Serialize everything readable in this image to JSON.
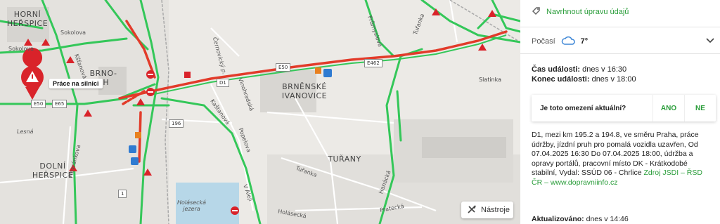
{
  "map": {
    "places": {
      "horni_herspice": "HORNÍ\nHEŘSPICE",
      "brno_jih": "BRNO-\nJIH",
      "brnenske_ivanovice": "BRNĚNSKÉ\nIVANOVICE",
      "turany": "TUŘANY",
      "dolni_herspice": "DOLNÍ\nHEŘSPICE",
      "slatinka": "Slatinka"
    },
    "streets": {
      "sokolova_top": "Sokolova",
      "sokolova_left": "Sokolova",
      "kstanova": "Kšťanová",
      "kastanova": "Kaštanová",
      "vinarska": "Vinohradská",
      "popelova": "Popelova",
      "havranova": "Havránkova",
      "lesna": "Lesná",
      "prumyslova": "Průmyslová",
      "turanka1": "Tuřanka",
      "turanka2": "Tuřanka",
      "holasecka": "Holásecká",
      "pratecka": "Pratecká",
      "hanacka": "Hanácká",
      "vatrej": "V Aleji",
      "cernovicky": "Černovický p.",
      "holasecka_jezera": "Holásecká\njezera"
    },
    "shields": {
      "e50_left": "E50",
      "e65": "E65",
      "e50_mid": "E50",
      "e462": "E462",
      "d1": "D1",
      "r196": "196",
      "r1": "1"
    },
    "incident_callout": "Práce na silnici",
    "tools_button": "Nástroje",
    "colors": {
      "congestion": "#e23b2a",
      "free_flow": "#34c759",
      "closure": "#d9232a"
    }
  },
  "panel": {
    "suggest_edit": "Navrhnout úpravu údajů",
    "weather_label": "Počasí",
    "weather_temp": "7°",
    "event_time_label": "Čas události:",
    "event_time_value": " dnes v 16:30",
    "event_end_label": "Konec události:",
    "event_end_value": " dnes v 18:00",
    "question": "Je toto omezení aktuální?",
    "answer_yes": "ANO",
    "answer_no": "NE",
    "description": "D1, mezi km 195.2 a 194.8, ve směru Praha, práce údržby, jízdní pruh pro pomalá vozidla uzavřen, Od 07.04.2025 16:30 Do 07.04.2025 18:00, údržba a opravy portálů, pracovní místo DK - Krátkodobé stabilní, Vydal: SSÚD 06 - Chrlice",
    "source_link": "Zdroj JSDI – ŘSD ČR – www.dopravniinfo.cz",
    "updated_label": "Aktualizováno:",
    "updated_value": " dnes v 14:46"
  }
}
